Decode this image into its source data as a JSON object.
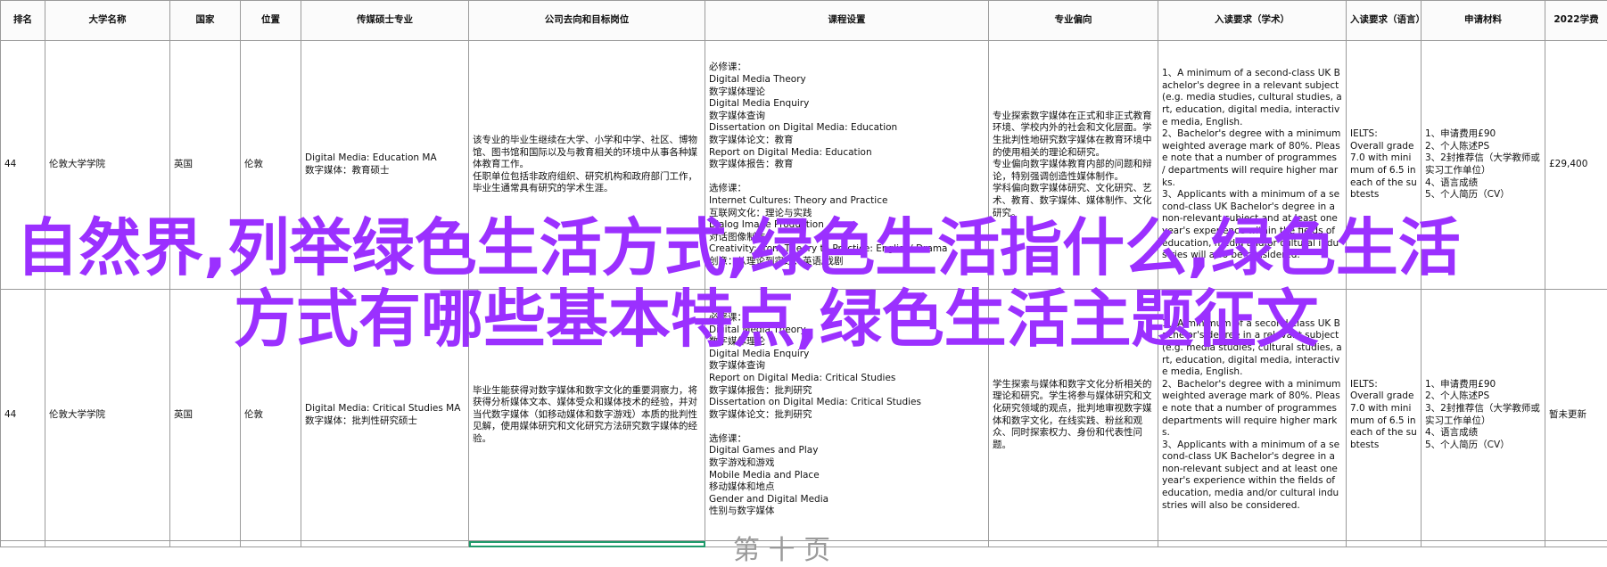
{
  "headers": [
    "排名",
    "大学名称",
    "国家",
    "位置",
    "传媒硕士专业",
    "公司去向和目标岗位",
    "课程设置",
    "专业偏向",
    "入读要求（学术）",
    "入读要求（语言）",
    "申请材料",
    "2022学费"
  ],
  "rows": [
    {
      "rank": "44",
      "university": "伦敦大学学院",
      "country": "英国",
      "location": "伦敦",
      "major": "Digital Media: Education MA\n数字媒体：教育硕士",
      "careers": "该专业的毕业生继续在大学、小学和中学、社区、博物馆、图书馆和国际以及与教育相关的环境中从事各种媒体教育工作。\n任职单位包括非政府组织、研究机构和政府部门工作，毕业生通常具有研究的学术生涯。",
      "courses": "必修课：\nDigital Media Theory\n数字媒体理论\nDigital Media Enquiry\n数字媒体查询\nDissertation on Digital Media: Education\n数字媒体论文：教育\nReport on Digital Media: Education\n数字媒体报告：教育\n\n选修课：\nInternet Cultures: Theory and Practice\n互联网文化：理论与实践\nDialog Image Production\n对话图像制作\nCreativity: from Theory to Practice: English/ Drama\n创意：从理论到实践：英语/戏剧",
      "focus": "专业探索数字媒体在正式和非正式教育环境、学校内外的社会和文化层面。学生批判性地研究数字媒体在教育环境中的使用相关的理论和研究。\n专业偏向数字媒体教育内部的问题和辩论，特别强调创造性媒体制作。\n学科偏向数字媒体研究、文化研究、艺术、教育、数字媒体、媒体制作、文化研究。",
      "academic": "1、A minimum of a second-class UK Bachelor's degree in a relevant subject (e.g. media studies, cultural studies, art, education, digital media, interactive media, English.\n2、Bachelor's degree with a minimum weighted average mark of 80%. Please note that a number of programmes / departments will require higher marks.\n3、Applicants with a minimum of a second-class UK Bachelor's degree in a non-relevant subject and at least one year's experience within the fields of education, media and/or cultural industries will also be considered.",
      "language": "IELTS:\nOverall grade 7.0 with minimum of 6.5 in each of the subtests",
      "materials": "1、申请费用£90\n2、个人陈述PS\n3、2封推荐信（大学教师或实习工作单位）\n4、语言成绩\n5、个人简历（CV）",
      "tuition": "£29,400"
    },
    {
      "rank": "44",
      "university": "伦敦大学学院",
      "country": "英国",
      "location": "伦敦",
      "major": "Digital Media: Critical Studies MA\n数字媒体：批判性研究硕士",
      "careers": "毕业生能获得对数字媒体和数字文化的重要洞察力，将获得分析媒体文本、媒体受众和媒体技术的经验，并对当代数字媒体（如移动媒体和数字游戏）本质的批判性见解，使用媒体研究和文化研究方法研究数字媒体的经验。",
      "courses": "必修课：\nDigital Media Theory\n数字媒体理论\nDigital Media Enquiry\n数字媒体查询\nReport on Digital Media: Critical Studies\n数字媒体报告：批判研究\nDissertation on Digital Media: Critical Studies\n数字媒体论文：批判研究\n\n选修课：\nDigital Games and Play\n数字游戏和游戏\nMobile Media and Place\n移动媒体和地点\nGender and Digital Media\n性别与数字媒体",
      "focus": "学生探索与媒体和数字文化分析相关的理论和研究。学生将参与媒体研究和文化研究领域的观点，批判地审视数字媒体和数字文化，在线实践、粉丝和观众、同时探索权力、身份和代表性问题。",
      "academic": "1、A minimum of a second-class UK Bachelor's degree in a relevant subject (e.g. media studies, cultural studies, art, education, digital media, interactive media, English.\n2、Bachelor's degree with a minimum weighted average mark of 80%. Please note that a number of programmes departments will require higher marks.\n3、Applicants with a minimum of a second-class UK Bachelor's degree in a non-relevant subject and at least one year's experience within the fields of education, media and/or cultural industries will also be considered.",
      "language": "IELTS:\nOverall grade 7.0 with minimum of 6.5 in each of the subtests",
      "materials": "1、申请费用£90\n2、个人陈述PS\n3、2封推荐信（大学教师或实习工作单位）\n4、语言成绩\n5、个人简历（CV）",
      "tuition": "暂未更新"
    }
  ],
  "overlay": {
    "line1": "自然界,列举绿色生活方式,绿色生活指什么,绿色生活",
    "line2": "方式有哪些基本特点,绿色生活主题征文"
  },
  "ghost_text": "第 十 页",
  "colors": {
    "overlay": "#9b30ff",
    "grid": "#9a9a9a",
    "selection": "#1f9a6a"
  }
}
